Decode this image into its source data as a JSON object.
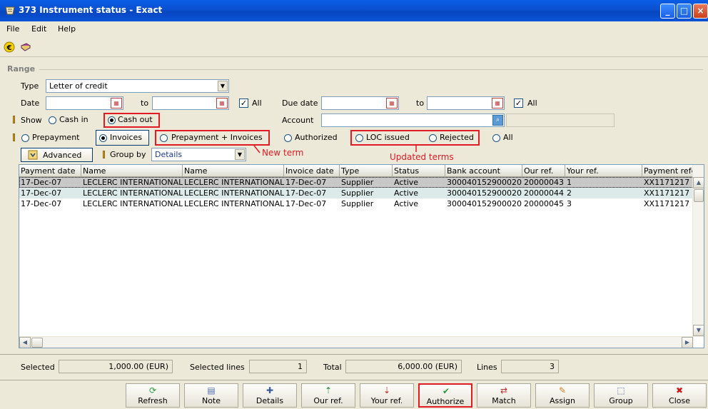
{
  "window": {
    "title": "373 Instrument status - Exact"
  },
  "menu": [
    "File",
    "Edit",
    "Help"
  ],
  "toolbar": {
    "icons": [
      "currency-euro-icon",
      "book-icon"
    ]
  },
  "range": {
    "section_label": "Range",
    "type_label": "Type",
    "type_value": "Letter of credit",
    "date_label": "Date",
    "to_label": "to",
    "all_label": "All",
    "date_all_checked": true,
    "due_date_label": "Due date",
    "due_to_label": "to",
    "due_all_label": "All",
    "due_all_checked": true,
    "show_label": "Show",
    "cash_in_label": "Cash in",
    "cash_out_label": "Cash out",
    "account_label": "Account",
    "prepayment_label": "Prepayment",
    "invoices_label": "Invoices",
    "prepayment_invoices_label": "Prepayment + Invoices",
    "authorized_label": "Authorized",
    "loc_issued_label": "LOC issued",
    "rejected_label": "Rejected",
    "all2_label": "All",
    "advanced_label": "Advanced",
    "group_by_label": "Group by",
    "group_by_value": "Details"
  },
  "annotations": {
    "new_term": "New term",
    "updated_terms": "Updated terms"
  },
  "grid": {
    "columns": [
      "Payment date",
      "Name",
      "Name",
      "Invoice date",
      "Type",
      "Status",
      "Bank account",
      "Our ref.",
      "Your ref.",
      "Payment refer"
    ],
    "rows": [
      [
        "17-Dec-07",
        "LECLERC INTERNATIONAL",
        "LECLERC INTERNATIONAL",
        "17-Dec-07",
        "Supplier",
        "Active",
        "300040152900020",
        "20000043",
        "1",
        "XX1171217"
      ],
      [
        "17-Dec-07",
        "LECLERC INTERNATIONAL",
        "LECLERC INTERNATIONAL",
        "17-Dec-07",
        "Supplier",
        "Active",
        "300040152900020",
        "20000044",
        "2",
        "XX1171217"
      ],
      [
        "17-Dec-07",
        "LECLERC INTERNATIONAL",
        "LECLERC INTERNATIONAL",
        "17-Dec-07",
        "Supplier",
        "Active",
        "300040152900020",
        "20000045",
        "3",
        "XX1171217"
      ]
    ]
  },
  "summary": {
    "selected_label": "Selected",
    "selected_value": "1,000.00 (EUR)",
    "selected_lines_label": "Selected lines",
    "selected_lines_value": "1",
    "total_label": "Total",
    "total_value": "6,000.00 (EUR)",
    "lines_label": "Lines",
    "lines_value": "3"
  },
  "buttons": [
    {
      "label": "Refresh",
      "icon": "refresh-icon"
    },
    {
      "label": "Note",
      "icon": "note-icon"
    },
    {
      "label": "Details",
      "icon": "details-icon"
    },
    {
      "label": "Our ref.",
      "icon": "our-ref-icon"
    },
    {
      "label": "Your ref.",
      "icon": "your-ref-icon"
    },
    {
      "label": "Authorize",
      "icon": "authorize-icon"
    },
    {
      "label": "Match",
      "icon": "match-icon"
    },
    {
      "label": "Assign",
      "icon": "assign-icon"
    },
    {
      "label": "Group",
      "icon": "group-icon"
    },
    {
      "label": "Close",
      "icon": "close-icon"
    }
  ],
  "colors": {
    "annotation_red": "#e01b24",
    "title_blue": "#0a5ee6",
    "selected_row": "#c8c8c8",
    "alt_row": "#dcebe9"
  }
}
